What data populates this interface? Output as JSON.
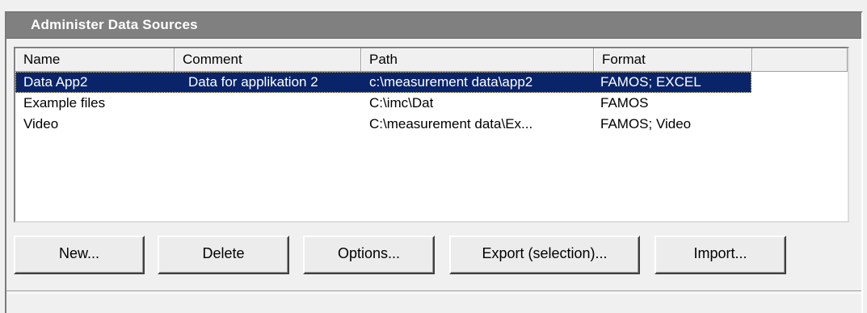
{
  "window": {
    "title": "Administer Data Sources"
  },
  "list": {
    "columns": [
      "Name",
      "Comment",
      "Path",
      "Format",
      ""
    ],
    "rows": [
      {
        "name": "Data App2",
        "comment": "Data for applikation 2",
        "path": "c:\\measurement data\\app2",
        "format": "FAMOS; EXCEL",
        "selected": true
      },
      {
        "name": "Example files",
        "comment": "",
        "path": "C:\\imc\\Dat",
        "format": "FAMOS",
        "selected": false
      },
      {
        "name": "Video",
        "comment": "",
        "path": "C:\\measurement data\\Ex...",
        "format": "FAMOS; Video",
        "selected": false
      }
    ]
  },
  "buttons": {
    "new": "New...",
    "delete": "Delete",
    "options": "Options...",
    "export": "Export (selection)...",
    "import": "Import..."
  },
  "colors": {
    "titlebar": "#808080",
    "selection": "#0a246a",
    "focus_outline": "#ffd000",
    "background": "#f0f0f0"
  }
}
